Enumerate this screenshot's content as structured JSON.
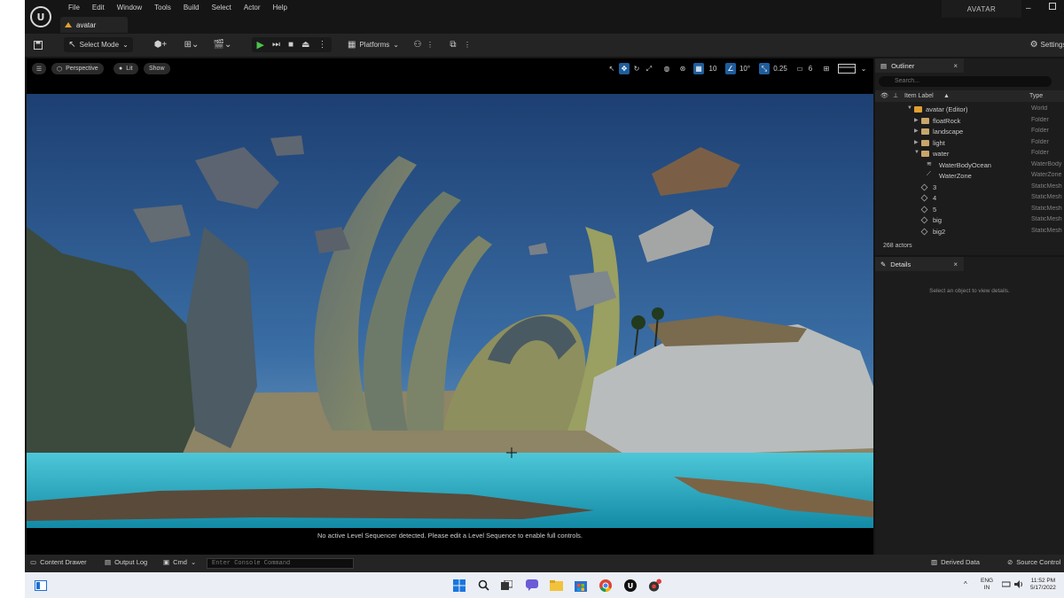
{
  "menu": [
    "File",
    "Edit",
    "Window",
    "Tools",
    "Build",
    "Select",
    "Actor",
    "Help"
  ],
  "doc_tab": "avatar",
  "project_name": "AVATAR",
  "toolbar": {
    "select_mode": "Select Mode",
    "platforms": "Platforms",
    "settings": "Settings"
  },
  "viewport": {
    "perspective": "Perspective",
    "lit": "Lit",
    "show": "Show",
    "grid_snap": "10",
    "rotate_snap": "10°",
    "scale_snap": "0.25",
    "camera_speed": "6",
    "message": "No active Level Sequencer detected. Please edit a Level Sequence to enable full controls."
  },
  "outliner": {
    "tab": "Outliner",
    "search_placeholder": "Search...",
    "col_label": "Item Label",
    "col_type": "Type",
    "rows": [
      {
        "label": "avatar (Editor)",
        "type": "World"
      },
      {
        "label": "floatRock",
        "type": "Folder"
      },
      {
        "label": "landscape",
        "type": "Folder"
      },
      {
        "label": "light",
        "type": "Folder"
      },
      {
        "label": "water",
        "type": "Folder"
      },
      {
        "label": "WaterBodyOcean",
        "type": "WaterBody"
      },
      {
        "label": "WaterZone",
        "type": "WaterZone"
      },
      {
        "label": "3",
        "type": "StaticMesh"
      },
      {
        "label": "4",
        "type": "StaticMesh"
      },
      {
        "label": "5",
        "type": "StaticMesh"
      },
      {
        "label": "big",
        "type": "StaticMesh"
      },
      {
        "label": "big2",
        "type": "StaticMesh"
      }
    ],
    "actors": "268 actors"
  },
  "details": {
    "tab": "Details",
    "empty": "Select an object to view details."
  },
  "statusbar": {
    "content_drawer": "Content Drawer",
    "output_log": "Output Log",
    "cmd": "Cmd",
    "console_placeholder": "Enter Console Command",
    "derived_data": "Derived Data",
    "source_control": "Source Control"
  },
  "taskbar": {
    "lang": "ENG",
    "region": "IN",
    "time": "11:52 PM",
    "date": "5/17/2022"
  },
  "colors": {
    "editor_bg": "#151515",
    "panel_bg": "#1c1c1c",
    "toolbar_bg": "#242424",
    "selection_blue": "#1f5d9c",
    "play_green": "#4cc24c",
    "taskbar_bg": "#ebeef4"
  }
}
